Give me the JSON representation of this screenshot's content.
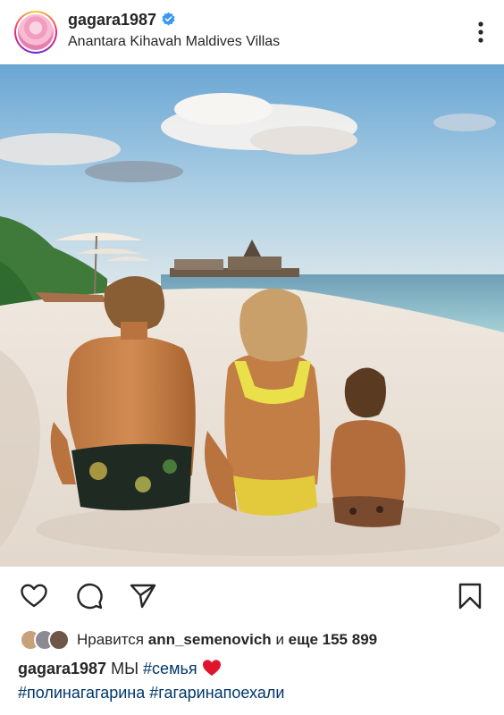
{
  "post": {
    "username": "gagara1987",
    "location": "Anantara Kihavah Maldives Villas",
    "verified": true
  },
  "likes": {
    "prefix": "Нравится",
    "user": "ann_semenovich",
    "connector": "и",
    "more_label": "еще 155 899"
  },
  "caption": {
    "username": "gagara1987",
    "text": "МЫ",
    "hashtag_1": "#семья",
    "hashtag_2": "#полинагагарина",
    "hashtag_3": "#гагаринапоехали",
    "emoji": "red-heart"
  },
  "colors": {
    "text": "#262626",
    "hashtag": "#00376b",
    "verified": "#3897f0",
    "heart": "#e0142d"
  },
  "icons": {
    "like": "heart-outline-icon",
    "comment": "comment-bubble-icon",
    "share": "paper-plane-icon",
    "save": "bookmark-icon",
    "more": "more-vertical-icon"
  }
}
